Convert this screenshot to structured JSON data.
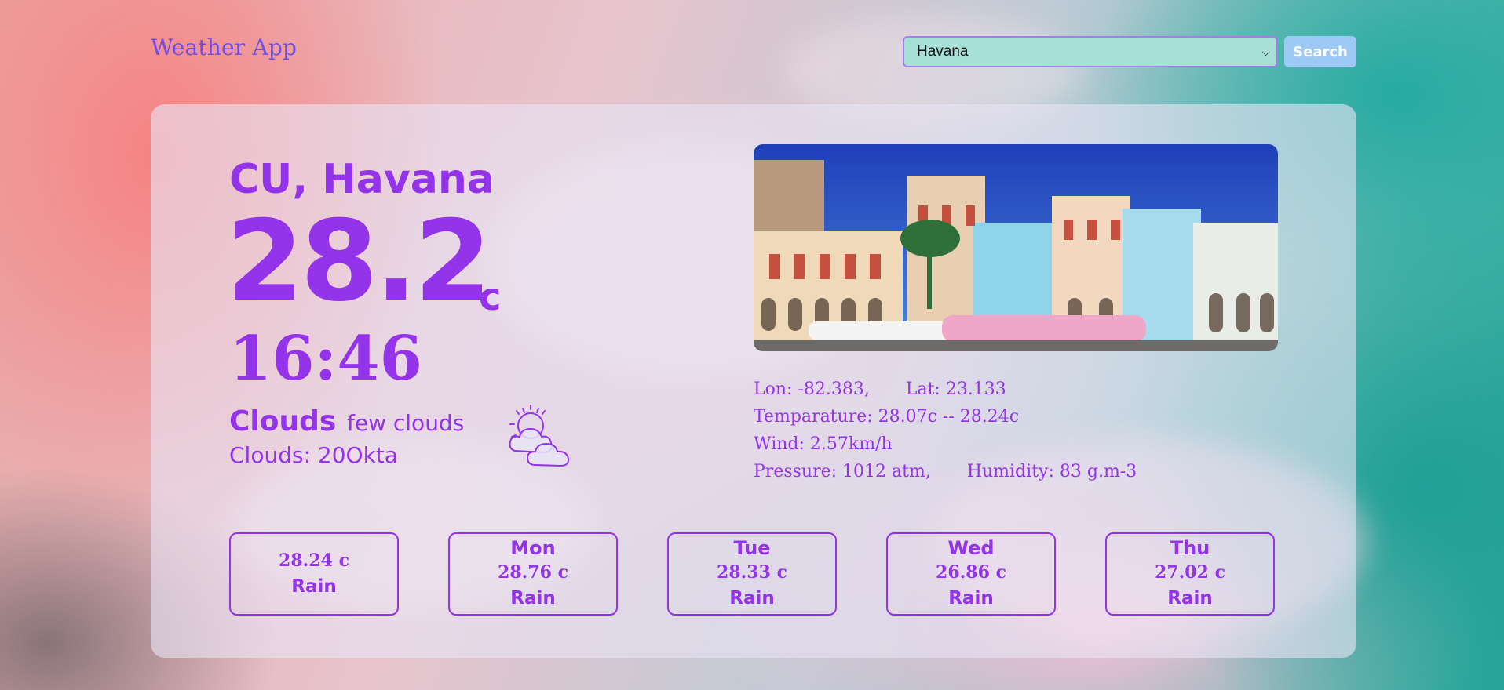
{
  "header": {
    "title": "Weather App",
    "city_selected": "Havana",
    "search_label": "Search"
  },
  "current": {
    "location": "CU, Havana",
    "temperature": "28.2",
    "temperature_unit": "c",
    "time": "16:46",
    "condition": "Clouds",
    "description": "few clouds",
    "clouds": "Clouds: 20Okta",
    "icon": "sun-behind-clouds-icon"
  },
  "details": {
    "lon": "Lon: -82.383,",
    "lat": "Lat: 23.133",
    "temperature_range": "Temparature: 28.07c -- 28.24c",
    "wind": "Wind: 2.57km/h",
    "pressure": "Pressure: 1012 atm,",
    "humidity": "Humidity: 83 g.m-3"
  },
  "forecast": [
    {
      "day": "",
      "temp": "28.24 c",
      "condition": "Rain"
    },
    {
      "day": "Mon",
      "temp": "28.76 c",
      "condition": "Rain"
    },
    {
      "day": "Tue",
      "temp": "28.33 c",
      "condition": "Rain"
    },
    {
      "day": "Wed",
      "temp": "26.86 c",
      "condition": "Rain"
    },
    {
      "day": "Thu",
      "temp": "27.02 c",
      "condition": "Rain"
    }
  ],
  "colors": {
    "accent": "#9333ea",
    "brand": "#6e4ee6",
    "select_bg": "#a6e0d7",
    "button_bg": "#9ccaf5"
  }
}
